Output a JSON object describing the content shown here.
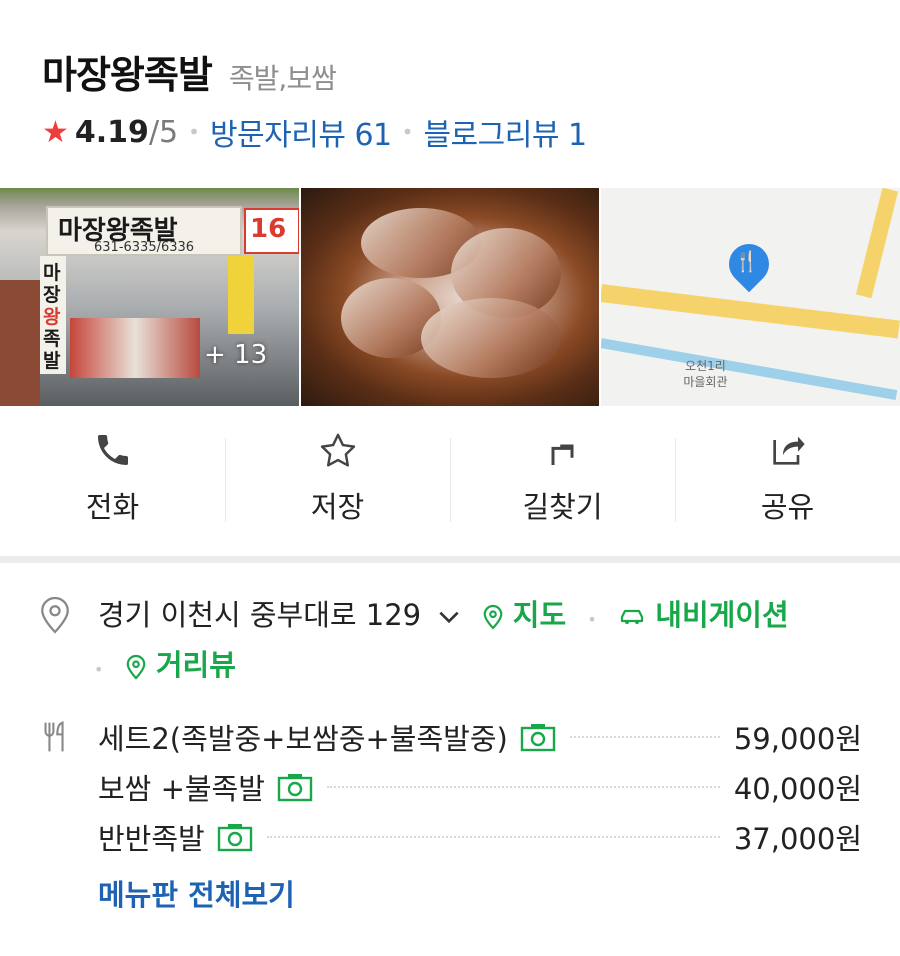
{
  "place": {
    "name": "마장왕족발",
    "category": "족발,보쌈",
    "rating": "4.19",
    "rating_max": "/5",
    "visitor_reviews": "방문자리뷰 61",
    "blog_reviews": "블로그리뷰 1"
  },
  "photos": {
    "store_sign": "마장왕족발",
    "store_phone": "631-6335/6336",
    "store_side": "16",
    "store_vertical": [
      "마",
      "장",
      "왕",
      "족",
      "발"
    ],
    "more_count": "+ 13",
    "map_label_1": "오천1리",
    "map_label_2": "마을회관",
    "pin_icon": "fork-knife-icon"
  },
  "actions": [
    {
      "label": "전화",
      "icon": "phone-icon"
    },
    {
      "label": "저장",
      "icon": "star-outline-icon"
    },
    {
      "label": "길찾기",
      "icon": "directions-icon"
    },
    {
      "label": "공유",
      "icon": "share-icon"
    }
  ],
  "address": {
    "text": "경기 이천시 중부대로 129",
    "map_link": "지도",
    "navigation_link": "내비게이션",
    "streetview_link": "거리뷰"
  },
  "menu": {
    "items": [
      {
        "name": "세트2(족발중+보쌈중+불족발중)",
        "price": "59,000원"
      },
      {
        "name": "보쌈 +불족발",
        "price": "40,000원"
      },
      {
        "name": "반반족발",
        "price": "37,000원"
      }
    ],
    "view_all": "메뉴판 전체보기"
  },
  "colors": {
    "link_blue": "#1e63b3",
    "link_green": "#18a84a",
    "rating_star": "#f03c3c",
    "map_pin": "#2f88e3"
  }
}
